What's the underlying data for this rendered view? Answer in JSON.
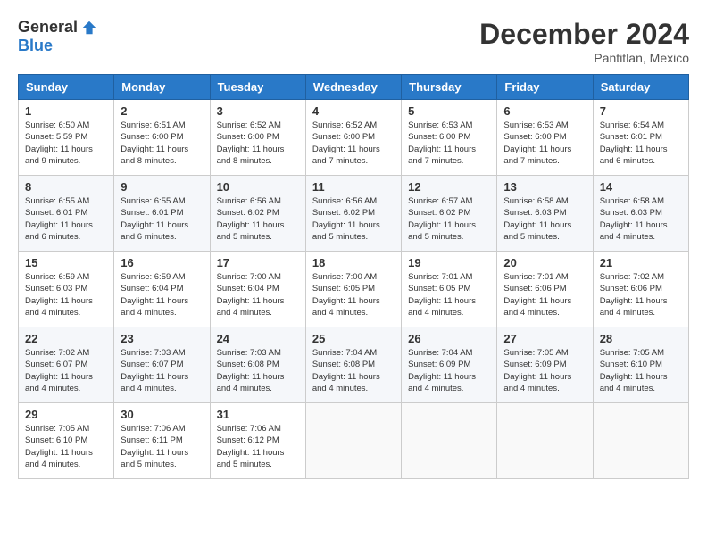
{
  "header": {
    "logo_general": "General",
    "logo_blue": "Blue",
    "month_title": "December 2024",
    "location": "Pantitlan, Mexico"
  },
  "calendar": {
    "days_of_week": [
      "Sunday",
      "Monday",
      "Tuesday",
      "Wednesday",
      "Thursday",
      "Friday",
      "Saturday"
    ],
    "weeks": [
      [
        null,
        null,
        null,
        null,
        null,
        null,
        null
      ]
    ]
  },
  "cells": {
    "w1": [
      {
        "day": "1",
        "info": "Sunrise: 6:50 AM\nSunset: 5:59 PM\nDaylight: 11 hours\nand 9 minutes."
      },
      {
        "day": "2",
        "info": "Sunrise: 6:51 AM\nSunset: 6:00 PM\nDaylight: 11 hours\nand 8 minutes."
      },
      {
        "day": "3",
        "info": "Sunrise: 6:52 AM\nSunset: 6:00 PM\nDaylight: 11 hours\nand 8 minutes."
      },
      {
        "day": "4",
        "info": "Sunrise: 6:52 AM\nSunset: 6:00 PM\nDaylight: 11 hours\nand 7 minutes."
      },
      {
        "day": "5",
        "info": "Sunrise: 6:53 AM\nSunset: 6:00 PM\nDaylight: 11 hours\nand 7 minutes."
      },
      {
        "day": "6",
        "info": "Sunrise: 6:53 AM\nSunset: 6:00 PM\nDaylight: 11 hours\nand 7 minutes."
      },
      {
        "day": "7",
        "info": "Sunrise: 6:54 AM\nSunset: 6:01 PM\nDaylight: 11 hours\nand 6 minutes."
      }
    ],
    "w2": [
      {
        "day": "8",
        "info": "Sunrise: 6:55 AM\nSunset: 6:01 PM\nDaylight: 11 hours\nand 6 minutes."
      },
      {
        "day": "9",
        "info": "Sunrise: 6:55 AM\nSunset: 6:01 PM\nDaylight: 11 hours\nand 6 minutes."
      },
      {
        "day": "10",
        "info": "Sunrise: 6:56 AM\nSunset: 6:02 PM\nDaylight: 11 hours\nand 5 minutes."
      },
      {
        "day": "11",
        "info": "Sunrise: 6:56 AM\nSunset: 6:02 PM\nDaylight: 11 hours\nand 5 minutes."
      },
      {
        "day": "12",
        "info": "Sunrise: 6:57 AM\nSunset: 6:02 PM\nDaylight: 11 hours\nand 5 minutes."
      },
      {
        "day": "13",
        "info": "Sunrise: 6:58 AM\nSunset: 6:03 PM\nDaylight: 11 hours\nand 5 minutes."
      },
      {
        "day": "14",
        "info": "Sunrise: 6:58 AM\nSunset: 6:03 PM\nDaylight: 11 hours\nand 4 minutes."
      }
    ],
    "w3": [
      {
        "day": "15",
        "info": "Sunrise: 6:59 AM\nSunset: 6:03 PM\nDaylight: 11 hours\nand 4 minutes."
      },
      {
        "day": "16",
        "info": "Sunrise: 6:59 AM\nSunset: 6:04 PM\nDaylight: 11 hours\nand 4 minutes."
      },
      {
        "day": "17",
        "info": "Sunrise: 7:00 AM\nSunset: 6:04 PM\nDaylight: 11 hours\nand 4 minutes."
      },
      {
        "day": "18",
        "info": "Sunrise: 7:00 AM\nSunset: 6:05 PM\nDaylight: 11 hours\nand 4 minutes."
      },
      {
        "day": "19",
        "info": "Sunrise: 7:01 AM\nSunset: 6:05 PM\nDaylight: 11 hours\nand 4 minutes."
      },
      {
        "day": "20",
        "info": "Sunrise: 7:01 AM\nSunset: 6:06 PM\nDaylight: 11 hours\nand 4 minutes."
      },
      {
        "day": "21",
        "info": "Sunrise: 7:02 AM\nSunset: 6:06 PM\nDaylight: 11 hours\nand 4 minutes."
      }
    ],
    "w4": [
      {
        "day": "22",
        "info": "Sunrise: 7:02 AM\nSunset: 6:07 PM\nDaylight: 11 hours\nand 4 minutes."
      },
      {
        "day": "23",
        "info": "Sunrise: 7:03 AM\nSunset: 6:07 PM\nDaylight: 11 hours\nand 4 minutes."
      },
      {
        "day": "24",
        "info": "Sunrise: 7:03 AM\nSunset: 6:08 PM\nDaylight: 11 hours\nand 4 minutes."
      },
      {
        "day": "25",
        "info": "Sunrise: 7:04 AM\nSunset: 6:08 PM\nDaylight: 11 hours\nand 4 minutes."
      },
      {
        "day": "26",
        "info": "Sunrise: 7:04 AM\nSunset: 6:09 PM\nDaylight: 11 hours\nand 4 minutes."
      },
      {
        "day": "27",
        "info": "Sunrise: 7:05 AM\nSunset: 6:09 PM\nDaylight: 11 hours\nand 4 minutes."
      },
      {
        "day": "28",
        "info": "Sunrise: 7:05 AM\nSunset: 6:10 PM\nDaylight: 11 hours\nand 4 minutes."
      }
    ],
    "w5": [
      {
        "day": "29",
        "info": "Sunrise: 7:05 AM\nSunset: 6:10 PM\nDaylight: 11 hours\nand 4 minutes."
      },
      {
        "day": "30",
        "info": "Sunrise: 7:06 AM\nSunset: 6:11 PM\nDaylight: 11 hours\nand 5 minutes."
      },
      {
        "day": "31",
        "info": "Sunrise: 7:06 AM\nSunset: 6:12 PM\nDaylight: 11 hours\nand 5 minutes."
      },
      null,
      null,
      null,
      null
    ]
  }
}
